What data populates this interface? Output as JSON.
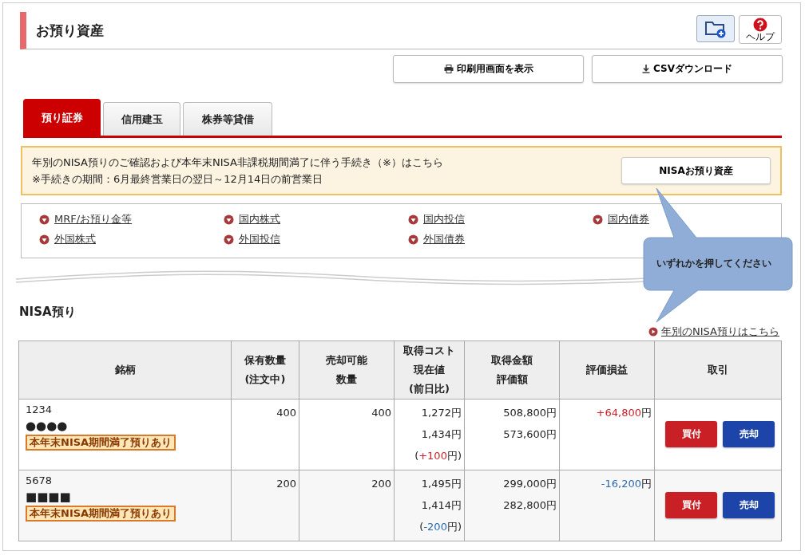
{
  "page_title": "お預り資産",
  "header_buttons": [
    {
      "kind": "folder"
    },
    {
      "kind": "help",
      "label": "ヘルプ"
    }
  ],
  "actions": [
    {
      "kind": "print",
      "label": "印刷用画面を表示"
    },
    {
      "kind": "download",
      "label": "CSVダウンロード"
    }
  ],
  "tabs": [
    {
      "label": "預り証券",
      "selected": true
    },
    {
      "label": "信用建玉",
      "selected": false
    },
    {
      "label": "株券等貸借",
      "selected": false
    }
  ],
  "notice": {
    "lines": [
      "年別のNISA預りのご確認および本年末NISA非課税期間満了に伴う手続き（※）はこちら",
      "※手続きの期間：6月最終営業日の翌日～12月14日の前営業日"
    ],
    "button": "NISAお預り資産"
  },
  "category_links": [
    "MRF/お預り金等",
    "国内株式",
    "国内投信",
    "国内債券",
    "外国株式",
    "外国投信",
    "外国債券"
  ],
  "callout": "いずれかを押してください",
  "section_title": "NISA預り",
  "section_link": "年別のNISA預りはこちら",
  "table": {
    "columns": [
      [
        "銘柄"
      ],
      [
        "保有数量",
        "(注文中)"
      ],
      [
        "売却可能",
        "数量"
      ],
      [
        "取得コスト",
        "現在値",
        "(前日比)"
      ],
      [
        "取得金額",
        "評価額"
      ],
      [
        "評価損益"
      ],
      [
        "取引"
      ]
    ],
    "rows": [
      {
        "code": "1234",
        "name": "●●●●",
        "tag": "本年末NISA期間満了預りあり",
        "holding": "400",
        "sellable": "400",
        "cost": "1,272円",
        "price": "1,434円",
        "change": {
          "open": "(",
          "value": "+100",
          "close": "円)"
        },
        "acquired": "508,800円",
        "valuation": "573,600円",
        "profit": {
          "value": "+64,800",
          "unit": "円"
        },
        "color": "#d0202a",
        "buy": "買付",
        "sell": "売却"
      },
      {
        "code": "5678",
        "name": "■■■■",
        "tag": "本年末NISA期間満了預りあり",
        "holding": "200",
        "sellable": "200",
        "cost": "1,495円",
        "price": "1,414円",
        "change": {
          "open": "(",
          "value": "-200",
          "close": "円)"
        },
        "acquired": "299,000円",
        "valuation": "282,800円",
        "profit": {
          "value": "-16,200",
          "unit": "円"
        },
        "color": "#2a6ab0",
        "buy": "買付",
        "sell": "売却"
      }
    ]
  }
}
